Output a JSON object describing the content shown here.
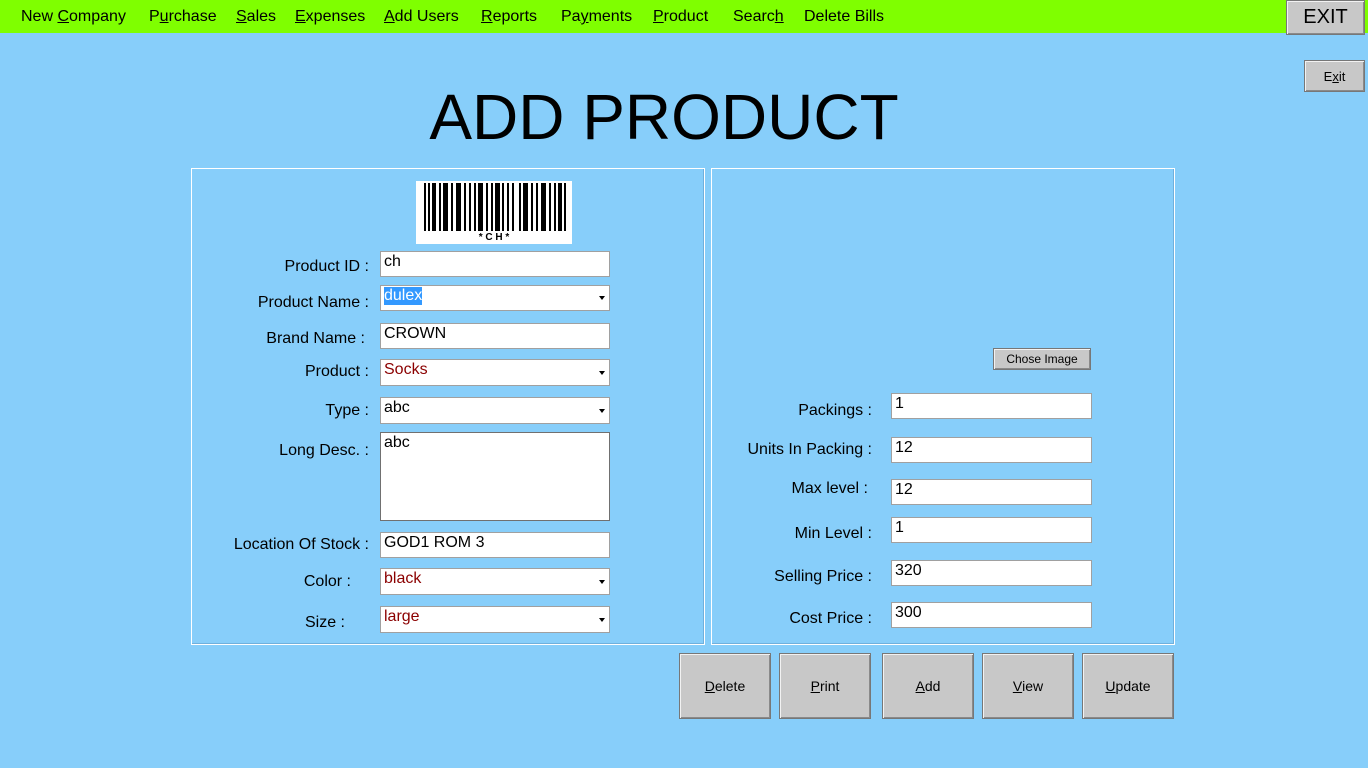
{
  "menu": {
    "items": [
      {
        "pre": "New ",
        "u": "C",
        "post": "ompany"
      },
      {
        "pre": "P",
        "u": "u",
        "post": "rchase"
      },
      {
        "pre": "",
        "u": "S",
        "post": "ales"
      },
      {
        "pre": "",
        "u": "E",
        "post": "xpenses"
      },
      {
        "pre": "",
        "u": "A",
        "post": "dd Users"
      },
      {
        "pre": "",
        "u": "R",
        "post": "eports"
      },
      {
        "pre": "Pa",
        "u": "y",
        "post": "ments"
      },
      {
        "pre": "",
        "u": "P",
        "post": "roduct"
      },
      {
        "pre": "Searc",
        "u": "h",
        "post": ""
      },
      {
        "pre": "Delete Bills",
        "u": "",
        "post": ""
      }
    ],
    "exit_label": "EXIT"
  },
  "small_exit": {
    "pre": "E",
    "u": "x",
    "post": "it"
  },
  "page_title": "ADD PRODUCT",
  "barcode_text": "* C H *",
  "left_form": {
    "product_id_label": "Product ID :",
    "product_id_value": "ch",
    "product_name_label": "Product Name :",
    "product_name_value": "dulex",
    "brand_name_label": "Brand Name :",
    "brand_name_value": "CROWN",
    "product_label": "Product :",
    "product_value": "Socks",
    "type_label": "Type :",
    "type_value": "abc",
    "long_desc_label": "Long Desc. :",
    "long_desc_value": "abc",
    "location_label": "Location Of Stock :",
    "location_value": "GOD1 ROM 3",
    "color_label": "Color :",
    "color_value": "black",
    "size_label": "Size :",
    "size_value": "large"
  },
  "right_form": {
    "chose_image_label": "Chose Image",
    "packings_label": "Packings :",
    "packings_value": "1",
    "units_label": "Units In Packing :",
    "units_value": "12",
    "max_label": "Max level :",
    "max_value": "12",
    "min_label": "Min Level :",
    "min_value": "1",
    "selling_label": "Selling Price :",
    "selling_value": "320",
    "cost_label": "Cost Price :",
    "cost_value": "300"
  },
  "actions": {
    "delete": {
      "u": "D",
      "post": "elete"
    },
    "print": {
      "u": "P",
      "post": "rint"
    },
    "add": {
      "u": "A",
      "post": "dd"
    },
    "view": {
      "u": "V",
      "post": "iew"
    },
    "update": {
      "u": "U",
      "post": "pdate"
    }
  },
  "colors": {
    "background": "#87CEFA",
    "menubar": "#7FFF00",
    "button": "#C8C8C8",
    "selected_text_bg": "#3399FF",
    "combo_text": "#8B0000"
  }
}
